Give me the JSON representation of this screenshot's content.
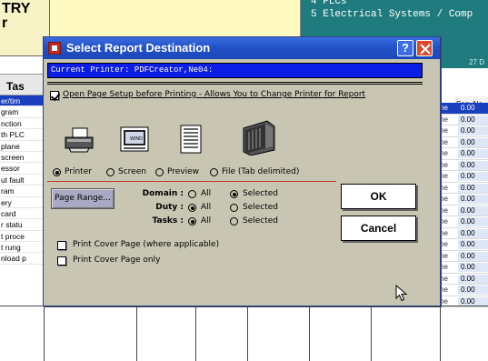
{
  "background": {
    "title": "TRY\nr",
    "teal_lines": [
      "4 PLCs",
      "5 Electrical Systems / Comp"
    ],
    "teal_date": "27 D",
    "tasks_header": "Tas",
    "seq_header": "Seq. No.",
    "task_rows": [
      "er/tim",
      "gram",
      "nction",
      "th PLC",
      "plane",
      "screen",
      "essor",
      "ut fault",
      "ram",
      "ery",
      "card",
      "r statu",
      "t proce",
      "t rung",
      "nload p"
    ],
    "seq_rows": [
      {
        "tag": "ne",
        "value": "0.00"
      },
      {
        "tag": "ne",
        "value": "0.00"
      },
      {
        "tag": "ne",
        "value": "0.00"
      },
      {
        "tag": "ne",
        "value": "0.00"
      },
      {
        "tag": "ne",
        "value": "0.00"
      },
      {
        "tag": "ne",
        "value": "0.00"
      },
      {
        "tag": "ne",
        "value": "0.00"
      },
      {
        "tag": "ne",
        "value": "0.00"
      },
      {
        "tag": "ne",
        "value": "0.00"
      },
      {
        "tag": "ne",
        "value": "0.00"
      },
      {
        "tag": "ne",
        "value": "0.00"
      },
      {
        "tag": "ne",
        "value": "0.00"
      },
      {
        "tag": "ne",
        "value": "0.00"
      },
      {
        "tag": "ne",
        "value": "0.00"
      },
      {
        "tag": "ne",
        "value": "0.00"
      },
      {
        "tag": "ne",
        "value": "0.00"
      },
      {
        "tag": "ne",
        "value": "0.00"
      },
      {
        "tag": "ne",
        "value": "0.00"
      }
    ],
    "selected_color": "#1a3fbf"
  },
  "dialog": {
    "title": "Select Report Destination",
    "help_label": "?",
    "current_printer": "Current Printer: PDFCreator,Ne04:",
    "page_setup_label": "Open Page Setup before Printing - Allows You to Change Printer for Report",
    "page_setup_checked": true,
    "destinations": [
      {
        "label": "Printer",
        "selected": true,
        "icon": "printer-icon"
      },
      {
        "label": "Screen",
        "selected": false,
        "icon": "screen-icon"
      },
      {
        "label": "Preview",
        "selected": false,
        "icon": "preview-icon"
      },
      {
        "label": "File (Tab delimited)",
        "selected": false,
        "icon": "file-cabinet-icon"
      }
    ],
    "page_range_label": "Page Range...",
    "domain": {
      "label": "Domain :",
      "all": "All",
      "selected": "Selected",
      "value": "Selected"
    },
    "duty": {
      "label": "Duty :",
      "all": "All",
      "selected": "Selected",
      "value": "All"
    },
    "tasks": {
      "label": "Tasks :",
      "all": "All",
      "selected": "Selected",
      "value": "All"
    },
    "cover_page_label": "Print Cover Page (where applicable)",
    "cover_only_label": "Print Cover Page only",
    "ok_label": "OK",
    "cancel_label": "Cancel",
    "colors": {
      "titlebar": "#2252c8",
      "printer_bar": "#0c1ee6",
      "dialog_bg": "#c8c6b2",
      "divider_red": "#c0392b"
    }
  }
}
